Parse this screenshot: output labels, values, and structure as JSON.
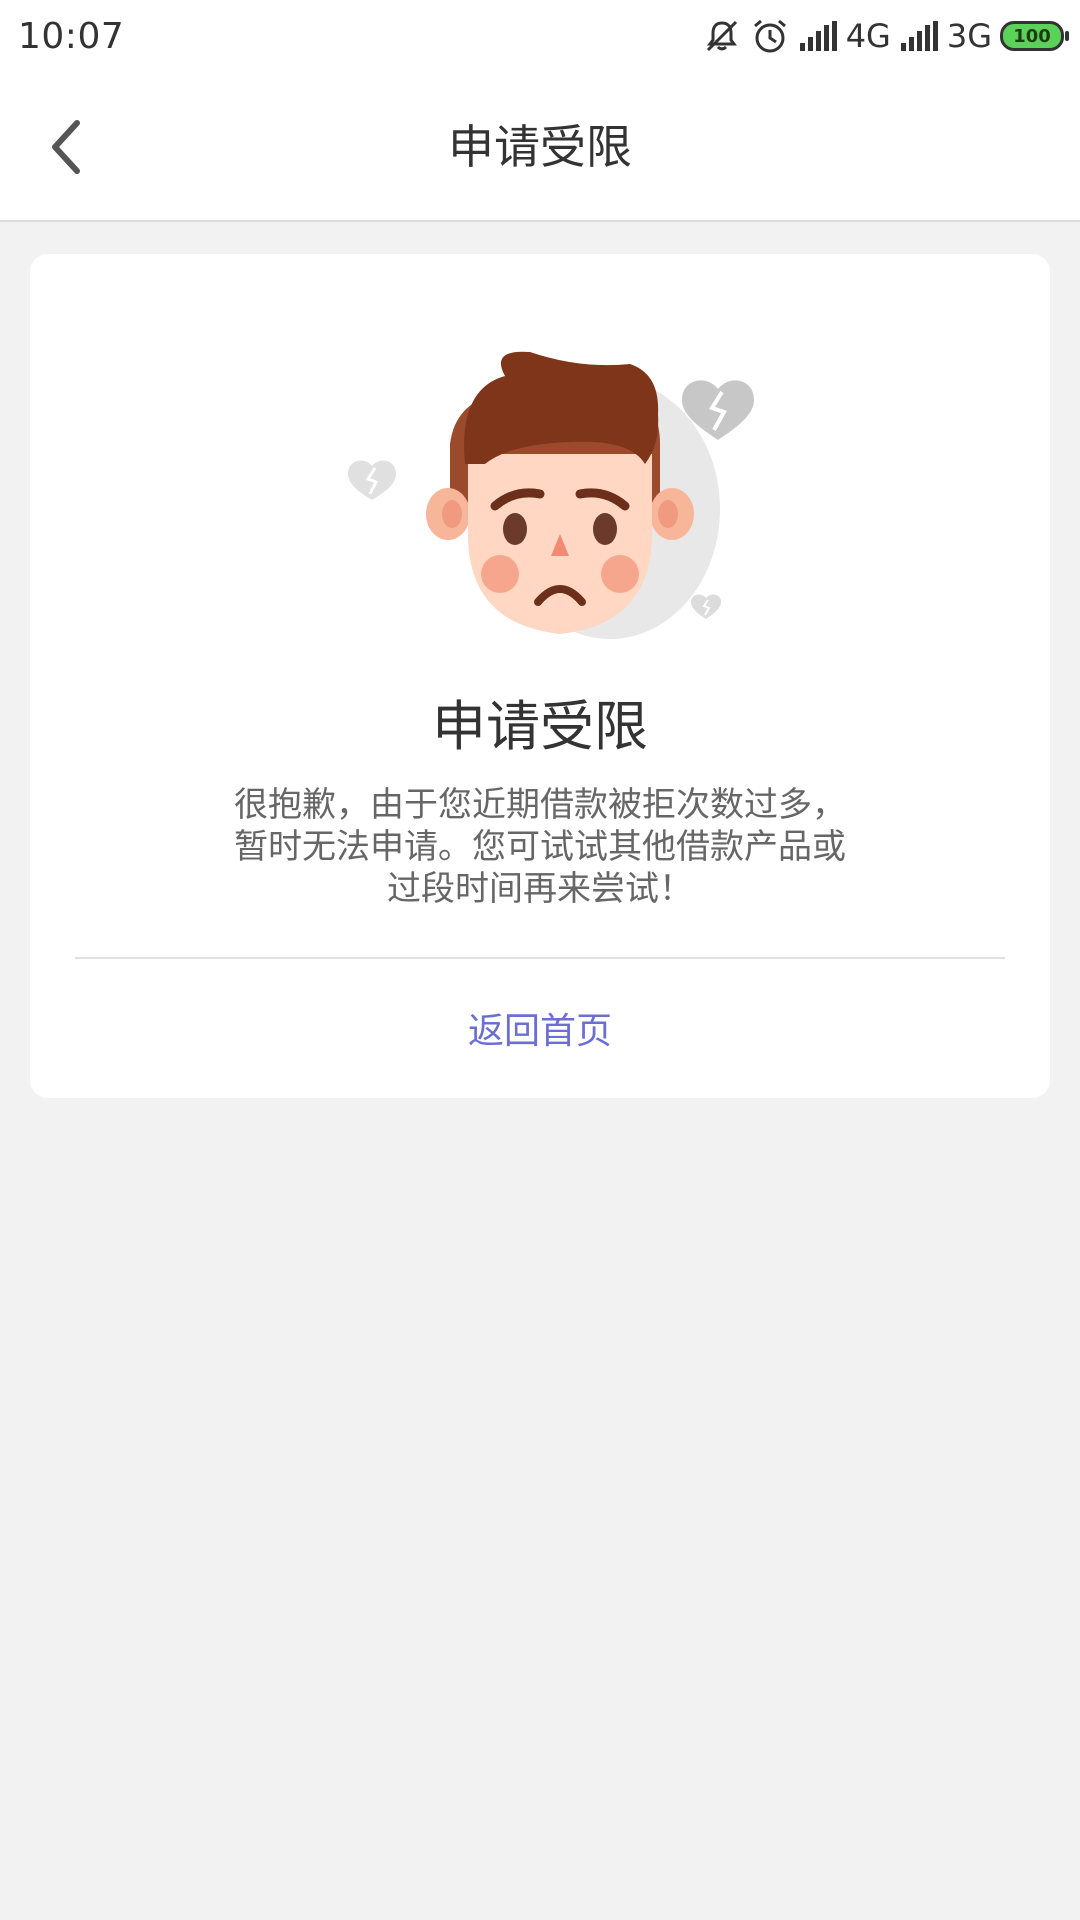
{
  "status_bar": {
    "time": "10:07",
    "network_1": "4G",
    "network_2": "3G",
    "battery": "100",
    "icons": [
      "mute-icon",
      "alarm-icon",
      "signal-icon",
      "signal-icon",
      "battery-icon"
    ],
    "battery_color": "#5bd15a"
  },
  "header": {
    "title": "申请受限",
    "back_icon": "chevron-left-icon"
  },
  "card": {
    "illustration": "sad-face-with-broken-hearts",
    "title": "申请受限",
    "message_lines": [
      "很抱歉，由于您近期借款被拒次数过多，",
      "暂时无法申请。您可试试其他借款产品或",
      "过段时间再来尝试！"
    ],
    "home_link": "返回首页",
    "link_color": "#6b6fd4"
  }
}
